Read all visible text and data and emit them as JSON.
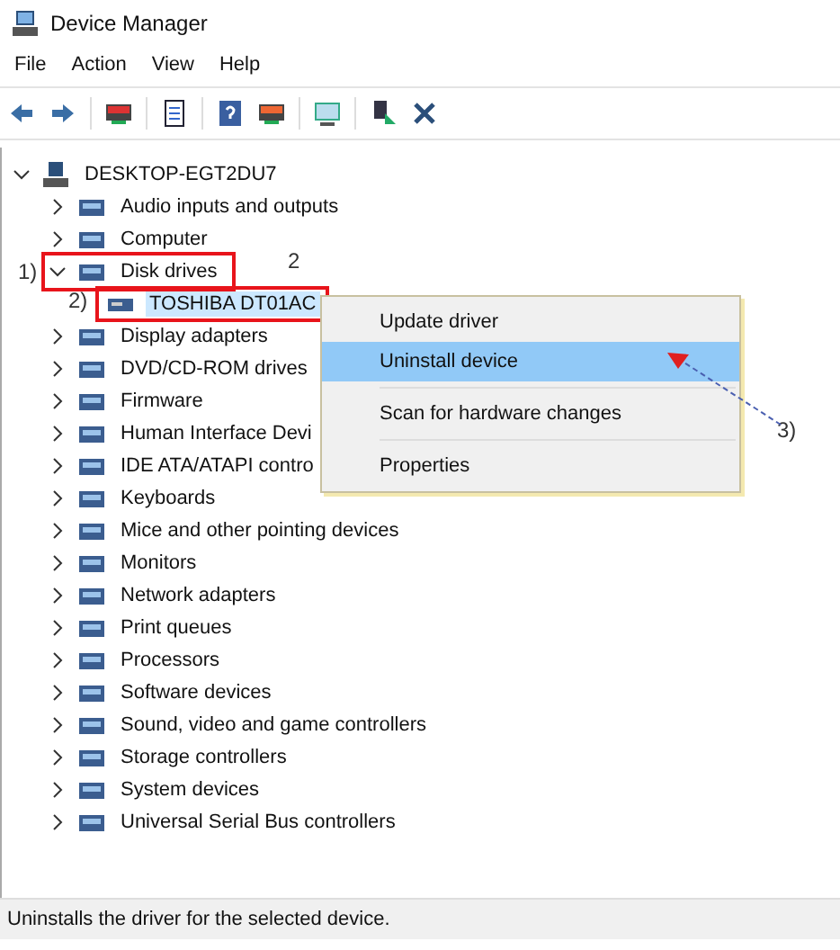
{
  "window": {
    "title": "Device Manager"
  },
  "menu_bar": [
    "File",
    "Action",
    "View",
    "Help"
  ],
  "tree": {
    "label": "DESKTOP-EGT2DU7",
    "expanded": true,
    "children": [
      {
        "label": "Audio inputs and outputs",
        "expanded": false,
        "boxed": false,
        "selected": false
      },
      {
        "label": "Computer",
        "expanded": false,
        "boxed": false,
        "selected": false
      },
      {
        "label": "Disk drives",
        "expanded": true,
        "boxed": true,
        "selected": false,
        "children": [
          {
            "label": "TOSHIBA DT01AC",
            "selected": true,
            "boxed": true
          }
        ]
      },
      {
        "label": "Display adapters",
        "expanded": false,
        "boxed": false,
        "selected": false
      },
      {
        "label": "DVD/CD-ROM drives",
        "expanded": false,
        "boxed": false,
        "selected": false
      },
      {
        "label": "Firmware",
        "expanded": false,
        "boxed": false,
        "selected": false
      },
      {
        "label": "Human Interface Devi",
        "expanded": false,
        "boxed": false,
        "selected": false
      },
      {
        "label": "IDE ATA/ATAPI contro",
        "expanded": false,
        "boxed": false,
        "selected": false
      },
      {
        "label": "Keyboards",
        "expanded": false,
        "boxed": false,
        "selected": false
      },
      {
        "label": "Mice and other pointing devices",
        "expanded": false,
        "boxed": false,
        "selected": false
      },
      {
        "label": "Monitors",
        "expanded": false,
        "boxed": false,
        "selected": false
      },
      {
        "label": "Network adapters",
        "expanded": false,
        "boxed": false,
        "selected": false
      },
      {
        "label": "Print queues",
        "expanded": false,
        "boxed": false,
        "selected": false
      },
      {
        "label": "Processors",
        "expanded": false,
        "boxed": false,
        "selected": false
      },
      {
        "label": "Software devices",
        "expanded": false,
        "boxed": false,
        "selected": false
      },
      {
        "label": "Sound, video and game controllers",
        "expanded": false,
        "boxed": false,
        "selected": false
      },
      {
        "label": "Storage controllers",
        "expanded": false,
        "boxed": false,
        "selected": false
      },
      {
        "label": "System devices",
        "expanded": false,
        "boxed": false,
        "selected": false
      },
      {
        "label": "Universal Serial Bus controllers",
        "expanded": false,
        "boxed": false,
        "selected": false
      }
    ]
  },
  "context_menu": [
    {
      "label": "Update driver",
      "selected": false,
      "separator_above": false
    },
    {
      "label": "Uninstall device",
      "selected": true,
      "separator_above": false
    },
    {
      "label": "Scan for hardware changes",
      "selected": false,
      "separator_above": true
    },
    {
      "label": "Properties",
      "selected": false,
      "separator_above": true
    }
  ],
  "annotations": [
    {
      "kind": "step1",
      "text": "1)"
    },
    {
      "kind": "step2_label",
      "text": "2"
    },
    {
      "kind": "step2",
      "text": "2)"
    },
    {
      "kind": "step3",
      "text": "3)"
    }
  ],
  "status_bar": "Uninstalls the driver for the selected device."
}
